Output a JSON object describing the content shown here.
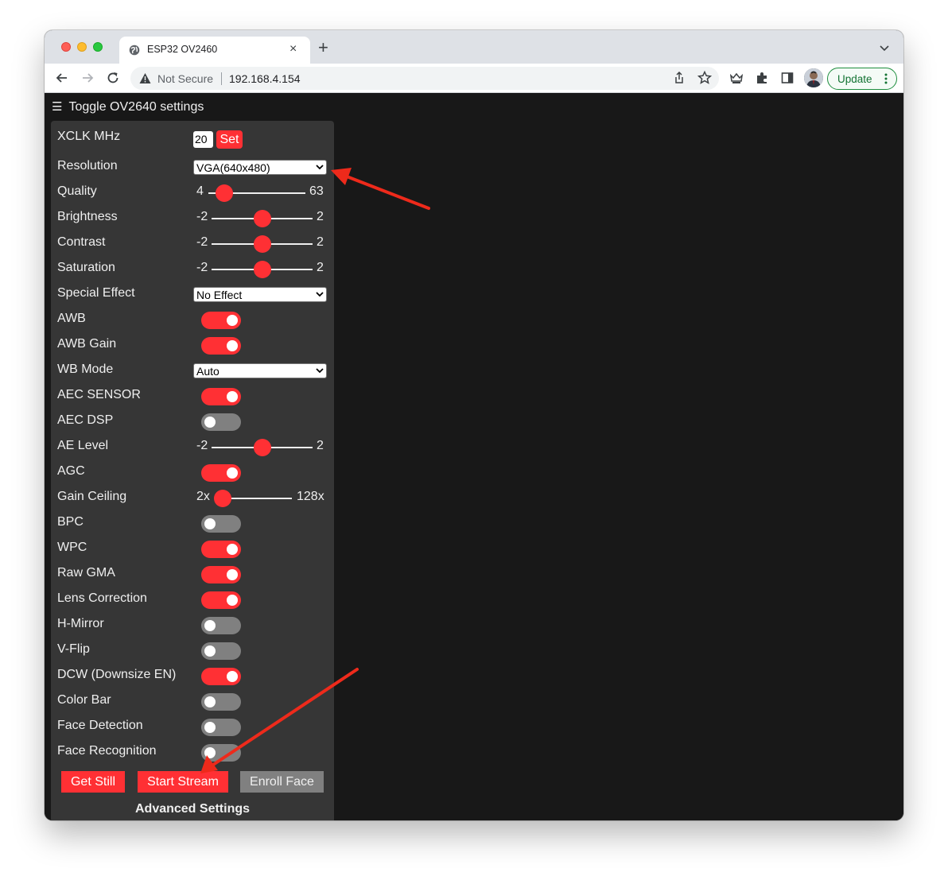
{
  "browser": {
    "tab_title": "ESP32 OV2460",
    "tab_close": "×",
    "new_tab": "+",
    "security_label": "Not Secure",
    "url": "192.168.4.154",
    "update_label": "Update"
  },
  "page": {
    "menu_icon": "☰",
    "menu_label": "Toggle OV2640 settings",
    "xclk": {
      "label": "XCLK MHz",
      "value": "20",
      "set_label": "Set"
    },
    "resolution": {
      "label": "Resolution",
      "value": "VGA(640x480)"
    },
    "quality": {
      "label": "Quality",
      "min": "4",
      "max": "63",
      "value": 10
    },
    "brightness": {
      "label": "Brightness",
      "min": "-2",
      "max": "2",
      "value": 0
    },
    "contrast": {
      "label": "Contrast",
      "min": "-2",
      "max": "2",
      "value": 0
    },
    "saturation": {
      "label": "Saturation",
      "min": "-2",
      "max": "2",
      "value": 0
    },
    "special_effect": {
      "label": "Special Effect",
      "value": "No Effect"
    },
    "awb": {
      "label": "AWB",
      "on": true
    },
    "awb_gain": {
      "label": "AWB Gain",
      "on": true
    },
    "wb_mode": {
      "label": "WB Mode",
      "value": "Auto"
    },
    "aec_sensor": {
      "label": "AEC SENSOR",
      "on": true
    },
    "aec_dsp": {
      "label": "AEC DSP",
      "on": false
    },
    "ae_level": {
      "label": "AE Level",
      "min": "-2",
      "max": "2",
      "value": 0
    },
    "agc": {
      "label": "AGC",
      "on": true
    },
    "gain_ceiling": {
      "label": "Gain Ceiling",
      "min": "2x",
      "max": "128x",
      "value": 0
    },
    "bpc": {
      "label": "BPC",
      "on": false
    },
    "wpc": {
      "label": "WPC",
      "on": true
    },
    "raw_gma": {
      "label": "Raw GMA",
      "on": true
    },
    "lens_correction": {
      "label": "Lens Correction",
      "on": true
    },
    "hmirror": {
      "label": "H-Mirror",
      "on": false
    },
    "vflip": {
      "label": "V-Flip",
      "on": false
    },
    "dcw": {
      "label": "DCW (Downsize EN)",
      "on": true
    },
    "color_bar": {
      "label": "Color Bar",
      "on": false
    },
    "face_detection": {
      "label": "Face Detection",
      "on": false
    },
    "face_recognition": {
      "label": "Face Recognition",
      "on": false
    },
    "buttons": {
      "get_still": "Get Still",
      "start_stream": "Start Stream",
      "enroll_face": "Enroll Face"
    },
    "advanced_label": "Advanced Settings"
  },
  "colors": {
    "accent": "#ff3034",
    "panel": "#363636",
    "page_bg": "#181818",
    "annotation_arrow": "#ee2a1b"
  }
}
